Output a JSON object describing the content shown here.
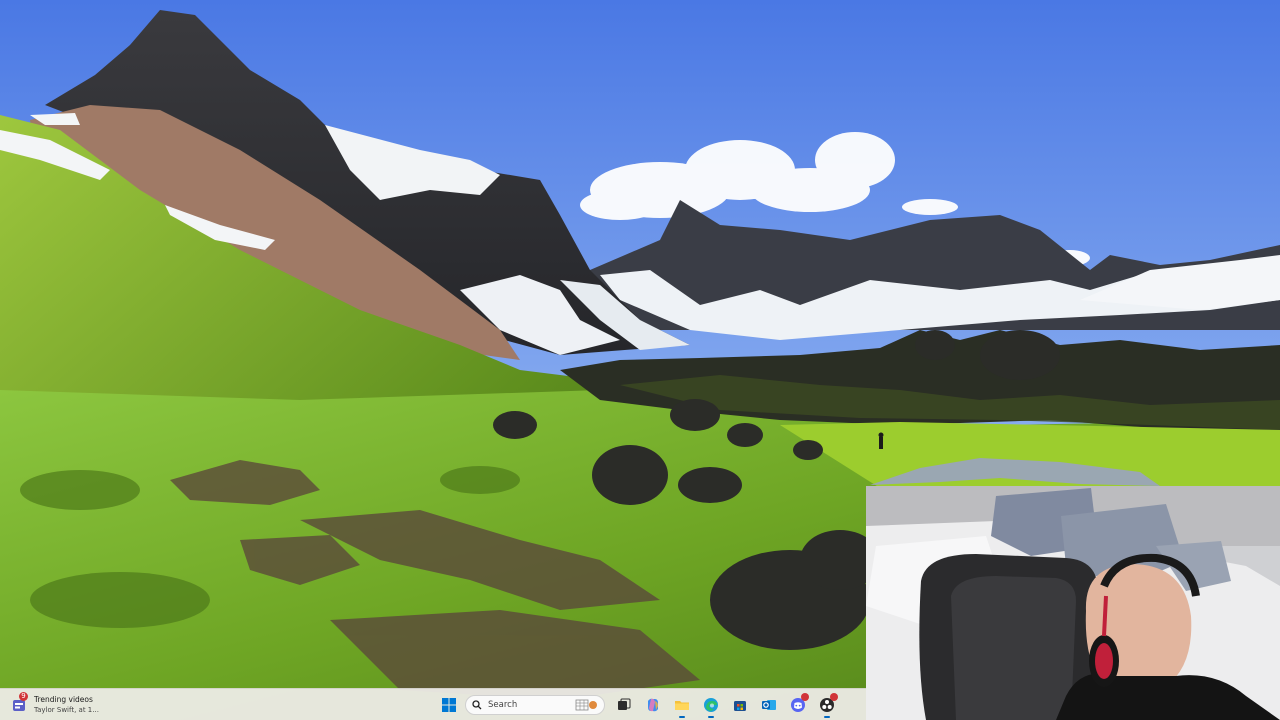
{
  "taskbar": {
    "widget": {
      "badge_count": "9",
      "title": "Trending videos",
      "subtitle": "Taylor Swift, at 1..."
    },
    "search": {
      "placeholder": "Search"
    },
    "apps": [
      {
        "name": "start",
        "icon": "windows-logo-icon"
      },
      {
        "name": "task-view",
        "icon": "task-view-icon"
      },
      {
        "name": "copilot",
        "icon": "copilot-icon"
      },
      {
        "name": "file-explorer",
        "icon": "folder-icon"
      },
      {
        "name": "edge",
        "icon": "edge-icon"
      },
      {
        "name": "store",
        "icon": "store-icon"
      },
      {
        "name": "outlook",
        "icon": "outlook-icon"
      },
      {
        "name": "discord",
        "icon": "discord-icon",
        "badge": true
      },
      {
        "name": "obs",
        "icon": "obs-icon",
        "badge": true
      }
    ]
  },
  "colors": {
    "sky_top": "#4f7fe6",
    "sky_bottom": "#9fbcf2",
    "grass": "#7fb82a",
    "accent": "#0067c0",
    "badge": "#d13438"
  }
}
